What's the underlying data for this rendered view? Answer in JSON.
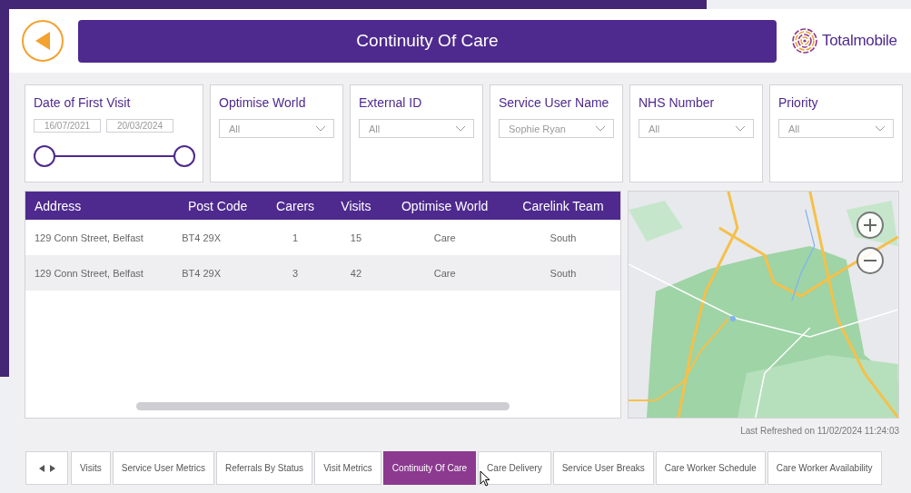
{
  "header": {
    "title": "Continuity Of Care",
    "brand": "Totalmobile"
  },
  "date_filter": {
    "label": "Date of First Visit",
    "from": "16/07/2021",
    "to": "20/03/2024"
  },
  "filters": [
    {
      "label": "Optimise World",
      "value": "All"
    },
    {
      "label": "External ID",
      "value": "All"
    },
    {
      "label": "Service User Name",
      "value": "Sophie Ryan"
    },
    {
      "label": "NHS Number",
      "value": "All"
    },
    {
      "label": "Priority",
      "value": "All"
    }
  ],
  "table": {
    "columns": [
      "Address",
      "Post Code",
      "Carers",
      "Visits",
      "Optimise World",
      "Carelink Team"
    ],
    "rows": [
      [
        "129 Conn Street, Belfast",
        "BT4 29X",
        "1",
        "15",
        "Care",
        "South"
      ],
      [
        "129 Conn Street, Belfast",
        "BT4 29X",
        "3",
        "42",
        "Care",
        "South"
      ]
    ]
  },
  "last_refreshed": "Last Refreshed on 11/02/2024 11:24:03",
  "tabs": [
    {
      "label": "Visits",
      "selected": false
    },
    {
      "label": "Service User Metrics",
      "selected": false
    },
    {
      "label": "Referrals By Status",
      "selected": false
    },
    {
      "label": "Visit Metrics",
      "selected": false
    },
    {
      "label": "Continuity Of Care",
      "selected": true
    },
    {
      "label": "Care Delivery",
      "selected": false
    },
    {
      "label": "Service User Breaks",
      "selected": false
    },
    {
      "label": "Care Worker Schedule",
      "selected": false
    },
    {
      "label": "Care Worker Availability",
      "selected": false
    }
  ]
}
